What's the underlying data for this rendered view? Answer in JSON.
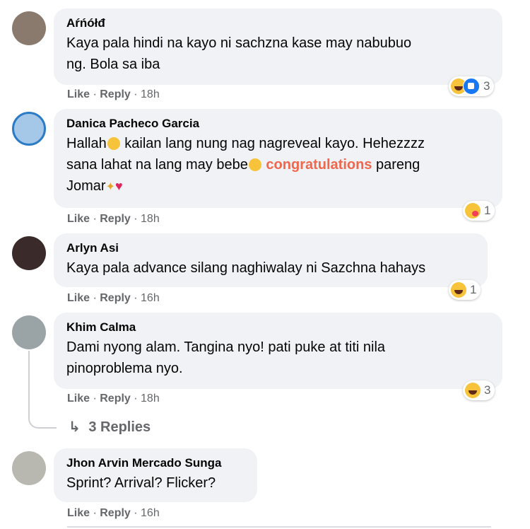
{
  "actions": {
    "like": "Like",
    "reply": "Reply",
    "sep": " · "
  },
  "comments": [
    {
      "name": "Aŕńółđ",
      "lines": [
        "Kaya pala hindi na kayo ni sachzna kase may nabubuo",
        "ng. Bola sa iba"
      ],
      "time": "18h",
      "reaction_count": "3"
    },
    {
      "name": "Danica Pacheco Garcia",
      "line1a": "Hallah",
      "line1b": " kailan lang nung nag nagreveal kayo. Hehezzzz",
      "line2a": "sana lahat na lang may bebe",
      "highlight": "congratulations",
      "line2b": " pareng",
      "line3": "Jomar",
      "time": "18h",
      "reaction_count": "1"
    },
    {
      "name": "Arlyn Asi",
      "lines": [
        "Kaya pala advance silang naghiwalay ni Sazchna hahays"
      ],
      "time": "16h",
      "reaction_count": "1"
    },
    {
      "name": "Khim Calma",
      "lines": [
        "Dami nyong alam. Tangina nyo! pati puke at titi nila",
        "pinoproblema nyo."
      ],
      "time": "18h",
      "reaction_count": "3"
    },
    {
      "name": "Jhon Arvin Mercado Sunga",
      "lines": [
        "Sprint? Arrival? Flicker?"
      ],
      "time": "16h"
    }
  ],
  "replies_label": "3 Replies",
  "icons": {
    "reply_arrow": "reply-arrow-icon"
  }
}
